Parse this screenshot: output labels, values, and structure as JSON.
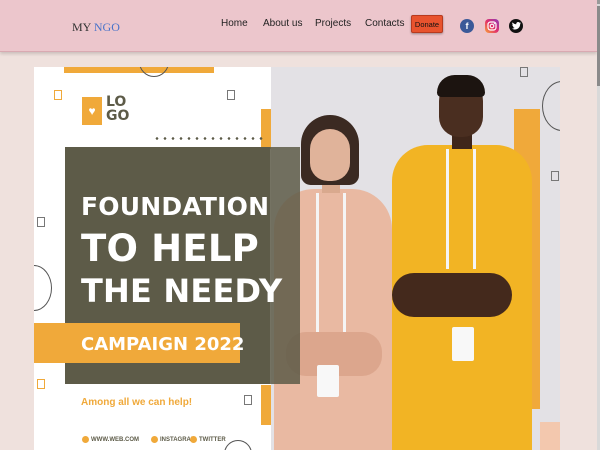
{
  "header": {
    "brand_prefix": "MY",
    "brand_suffix": "NGO",
    "nav": [
      "Home",
      "About us",
      "Projects",
      "Contacts"
    ],
    "donate_label": "Donate",
    "social": [
      "facebook-icon",
      "instagram-icon",
      "twitter-icon"
    ]
  },
  "banner": {
    "logo_text_1": "LO",
    "logo_text_2": "GO",
    "headline_1": "FOUNDATION",
    "headline_2": "TO HELP",
    "headline_3": "THE NEEDY",
    "campaign": "CAMPAIGN 2022",
    "tagline": "Among all we can help!",
    "footer": [
      "WWW.WEB.COM",
      "INSTAGRAM",
      "TWITTER"
    ]
  },
  "colors": {
    "header_bg": "#ecc6cc",
    "accent_orange": "#f0a93a",
    "olive": "#5d5b48",
    "donate_red": "#e8532e"
  }
}
